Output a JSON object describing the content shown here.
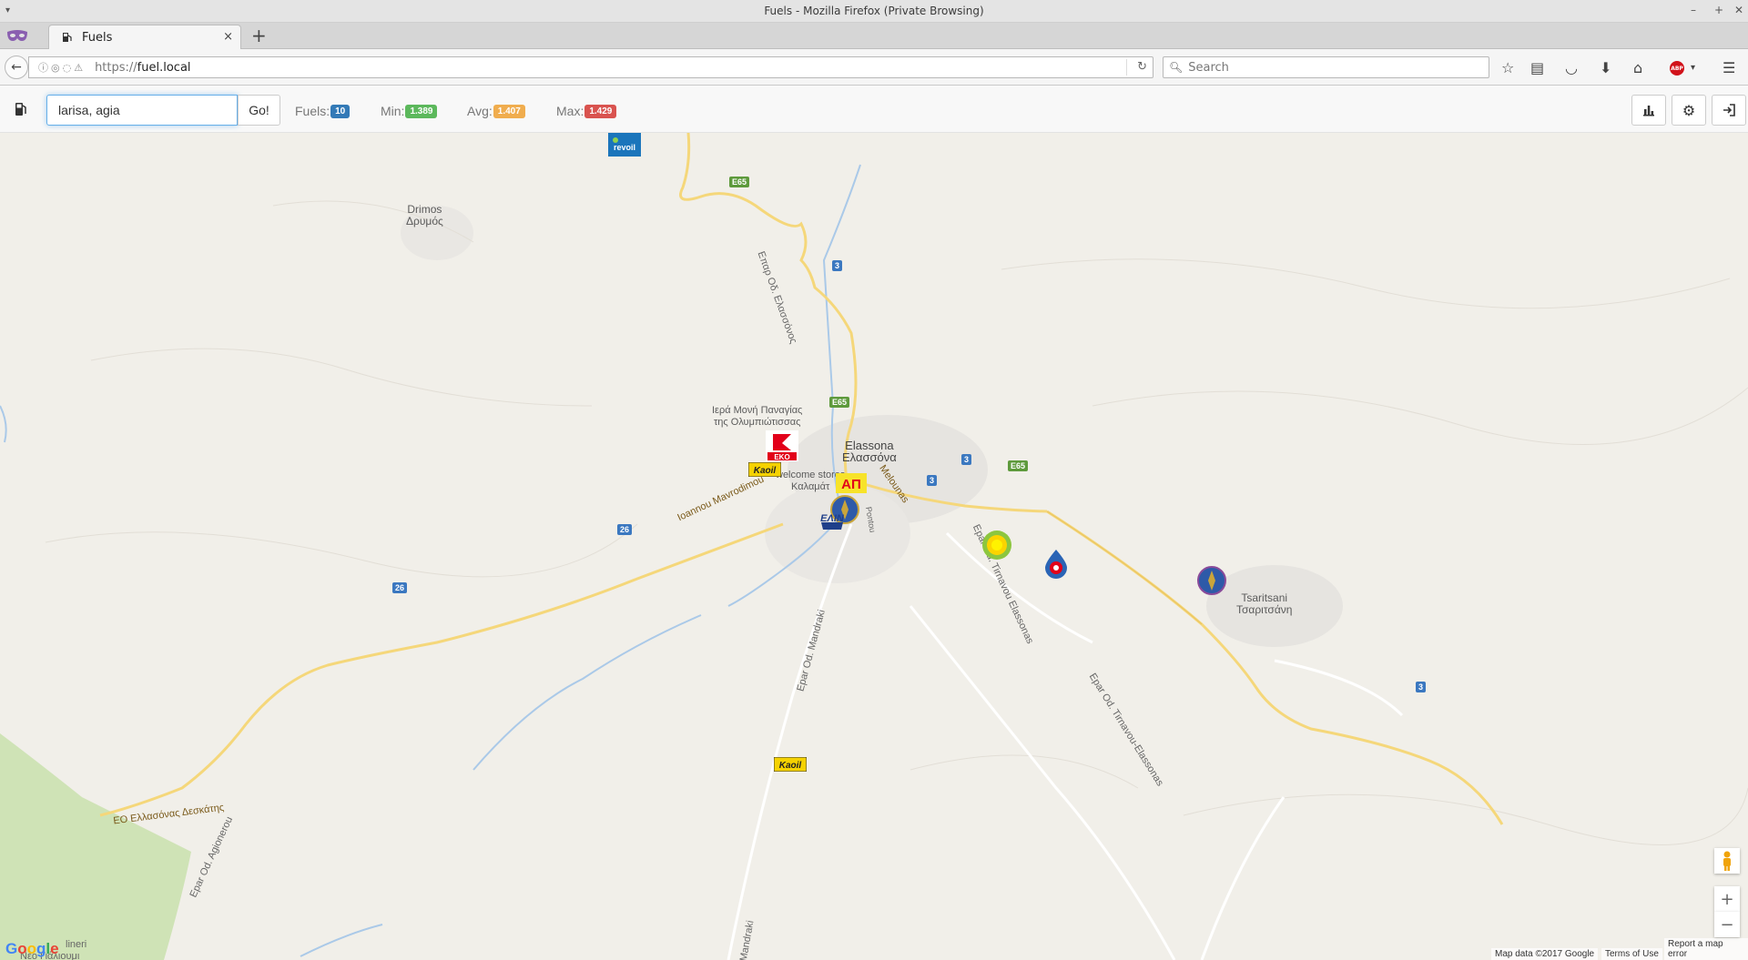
{
  "window": {
    "title": "Fuels - Mozilla Firefox (Private Browsing)"
  },
  "tab": {
    "label": "Fuels",
    "close": "×",
    "new_tab": "+"
  },
  "navbar": {
    "url_scheme": "https://",
    "url_host": "fuel.local",
    "search_placeholder": "Search"
  },
  "app": {
    "search_value": "larisa, agia",
    "go_label": "Go!",
    "stats": {
      "fuels_label": "Fuels:",
      "fuels_value": "10",
      "min_label": "Min:",
      "min_value": "1.389",
      "avg_label": "Avg:",
      "avg_value": "1.407",
      "max_label": "Max:",
      "max_value": "1.429"
    },
    "colors": {
      "fuels": "#337ab7",
      "min": "#5cb85c",
      "avg": "#f0ad4e",
      "max": "#d9534f"
    }
  },
  "map": {
    "places": [
      {
        "name": "Drimos",
        "name_gr": "Δρυμός"
      },
      {
        "name": "Elassona",
        "name_gr": "Ελασσόνα"
      },
      {
        "name": "Tsaritsani",
        "name_gr": "Τσαριτσάνη"
      }
    ],
    "poi": {
      "monastery": "Ιερά Μονή Παναγίας",
      "monastery2": "της Ολυμπιώτισσας",
      "store": "welcome stores",
      "store2": "Καλαμάτ"
    },
    "roads": {
      "r1": "Ioannou Mavrodimou",
      "r2": "Melounas",
      "r3": "Epar Od. Tirnavou Elassonas",
      "r4": "Epar Od. Tirnavou-Elassonas",
      "r5": "Epar Od. Mandraki",
      "r6": "ΕΟ Ελλασόνας Δεσκάτης",
      "r7": "Epar Od. Agionerou",
      "r8": "Επαρ Οδ. Ελασσόνος",
      "r9": "Pontou",
      "r10": "Mandraki",
      "r11": "lineri",
      "r12": "Νέο Γιάλιουμι"
    },
    "shields": {
      "e65": "E65",
      "r3": "3",
      "r26": "26"
    },
    "brands": [
      "revoil",
      "EKO",
      "Kaoil",
      "ΑΠ",
      "ΕΛΙΝ",
      "BP",
      "Kaoil",
      "Cyclon",
      "Cyclon",
      "Elin"
    ],
    "attribution": {
      "data": "Map data ©2017 Google",
      "terms": "Terms of Use",
      "report": "Report a map error"
    },
    "zoom_in": "+",
    "zoom_out": "−",
    "google": "Google"
  }
}
